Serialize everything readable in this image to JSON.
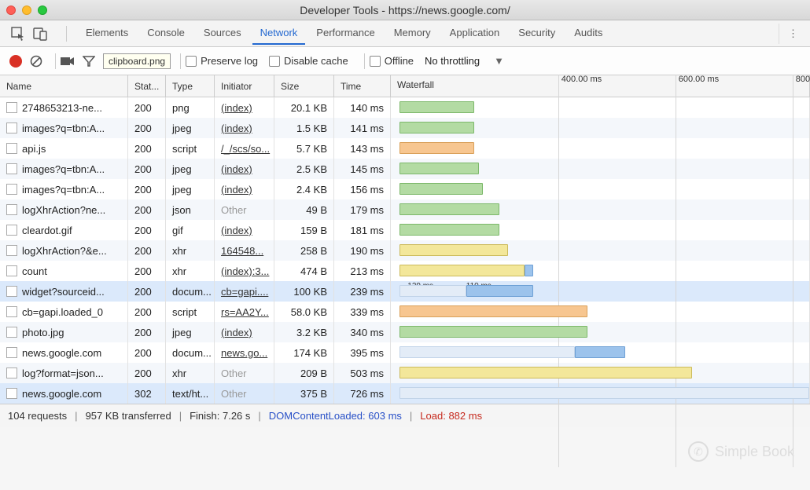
{
  "window": {
    "title": "Developer Tools - https://news.google.com/"
  },
  "tabs": {
    "items": [
      "Elements",
      "Console",
      "Sources",
      "Network",
      "Performance",
      "Memory",
      "Application",
      "Security",
      "Audits"
    ],
    "active": "Network"
  },
  "toolbar": {
    "tooltip": "clipboard.png",
    "preserve_log": "Preserve log",
    "disable_cache": "Disable cache",
    "offline": "Offline",
    "throttling": "No throttling"
  },
  "columns": {
    "name": "Name",
    "status": "Stat...",
    "type": "Type",
    "initiator": "Initiator",
    "size": "Size",
    "time": "Time",
    "waterfall": "Waterfall"
  },
  "waterfall_scale": {
    "ticks": [
      {
        "pos_pct": 40,
        "label": "400.00 ms"
      },
      {
        "pos_pct": 68,
        "label": "600.00 ms"
      },
      {
        "pos_pct": 96,
        "label": "800"
      }
    ],
    "max_ms": 800
  },
  "requests": [
    {
      "name": "2748653213-ne...",
      "status": "200",
      "type": "png",
      "initiator": "(index)",
      "init_style": "link",
      "size": "20.1 KB",
      "time": "140 ms",
      "bars": [
        {
          "start": 0,
          "len": 18,
          "cls": "bar-green"
        }
      ]
    },
    {
      "name": "images?q=tbn:A...",
      "status": "200",
      "type": "jpeg",
      "initiator": "(index)",
      "init_style": "link",
      "size": "1.5 KB",
      "time": "141 ms",
      "bars": [
        {
          "start": 0,
          "len": 18,
          "cls": "bar-green"
        }
      ]
    },
    {
      "name": "api.js",
      "status": "200",
      "type": "script",
      "initiator": "/_/scs/so...",
      "init_style": "link",
      "size": "5.7 KB",
      "time": "143 ms",
      "bars": [
        {
          "start": 0,
          "len": 18,
          "cls": "bar-orange"
        }
      ]
    },
    {
      "name": "images?q=tbn:A...",
      "status": "200",
      "type": "jpeg",
      "initiator": "(index)",
      "init_style": "link",
      "size": "2.5 KB",
      "time": "145 ms",
      "bars": [
        {
          "start": 0,
          "len": 19,
          "cls": "bar-green"
        }
      ]
    },
    {
      "name": "images?q=tbn:A...",
      "status": "200",
      "type": "jpeg",
      "initiator": "(index)",
      "init_style": "link",
      "size": "2.4 KB",
      "time": "156 ms",
      "bars": [
        {
          "start": 0,
          "len": 20,
          "cls": "bar-green"
        }
      ]
    },
    {
      "name": "logXhrAction?ne...",
      "status": "200",
      "type": "json",
      "initiator": "Other",
      "init_style": "other",
      "size": "49 B",
      "time": "179 ms",
      "bars": [
        {
          "start": 0,
          "len": 24,
          "cls": "bar-green"
        }
      ]
    },
    {
      "name": "cleardot.gif",
      "status": "200",
      "type": "gif",
      "initiator": "(index)",
      "init_style": "link",
      "size": "159 B",
      "time": "181 ms",
      "bars": [
        {
          "start": 0,
          "len": 24,
          "cls": "bar-green"
        }
      ]
    },
    {
      "name": "logXhrAction?&e...",
      "status": "200",
      "type": "xhr",
      "initiator": "164548...",
      "init_style": "link",
      "size": "258 B",
      "time": "190 ms",
      "bars": [
        {
          "start": 0,
          "len": 26,
          "cls": "bar-yellow"
        }
      ]
    },
    {
      "name": "count",
      "status": "200",
      "type": "xhr",
      "initiator": "(index):3...",
      "init_style": "link",
      "size": "474 B",
      "time": "213 ms",
      "bars": [
        {
          "start": 0,
          "len": 30,
          "cls": "bar-yellow"
        },
        {
          "start": 30,
          "len": 2,
          "cls": "bar-blue"
        }
      ]
    },
    {
      "name": "widget?sourceid...",
      "status": "200",
      "type": "docum...",
      "initiator": "cb=gapi....",
      "init_style": "link",
      "size": "100 KB",
      "time": "239 ms",
      "selected": true,
      "bars": [
        {
          "start": 0,
          "len": 16,
          "cls": "bar-lightblue",
          "label": "129 ms",
          "label_pos": 4
        },
        {
          "start": 16,
          "len": 16,
          "cls": "bar-blue",
          "label": "110 ms",
          "label_pos": 18
        }
      ]
    },
    {
      "name": "cb=gapi.loaded_0",
      "status": "200",
      "type": "script",
      "initiator": "rs=AA2Y...",
      "init_style": "link",
      "size": "58.0 KB",
      "time": "339 ms",
      "bars": [
        {
          "start": 0,
          "len": 45,
          "cls": "bar-orange"
        }
      ]
    },
    {
      "name": "photo.jpg",
      "status": "200",
      "type": "jpeg",
      "initiator": "(index)",
      "init_style": "link",
      "size": "3.2 KB",
      "time": "340 ms",
      "bars": [
        {
          "start": 0,
          "len": 45,
          "cls": "bar-green"
        }
      ]
    },
    {
      "name": "news.google.com",
      "status": "200",
      "type": "docum...",
      "initiator": "news.go...",
      "init_style": "link",
      "size": "174 KB",
      "time": "395 ms",
      "bars": [
        {
          "start": 0,
          "len": 42,
          "cls": "bar-lightblue"
        },
        {
          "start": 42,
          "len": 12,
          "cls": "bar-blue"
        }
      ]
    },
    {
      "name": "log?format=json...",
      "status": "200",
      "type": "xhr",
      "initiator": "Other",
      "init_style": "other",
      "size": "209 B",
      "time": "503 ms",
      "bars": [
        {
          "start": 0,
          "len": 70,
          "cls": "bar-yellow"
        }
      ]
    },
    {
      "name": "news.google.com",
      "status": "302",
      "type": "text/ht...",
      "initiator": "Other",
      "init_style": "other",
      "size": "375 B",
      "time": "726 ms",
      "selected": true,
      "bars": [
        {
          "start": 0,
          "len": 98,
          "cls": "bar-lightblue"
        }
      ]
    }
  ],
  "status": {
    "requests": "104 requests",
    "transferred": "957 KB transferred",
    "finish": "Finish: 7.26 s",
    "dcl": "DOMContentLoaded: 603 ms",
    "load": "Load: 882 ms"
  },
  "watermark": "Simple Book"
}
